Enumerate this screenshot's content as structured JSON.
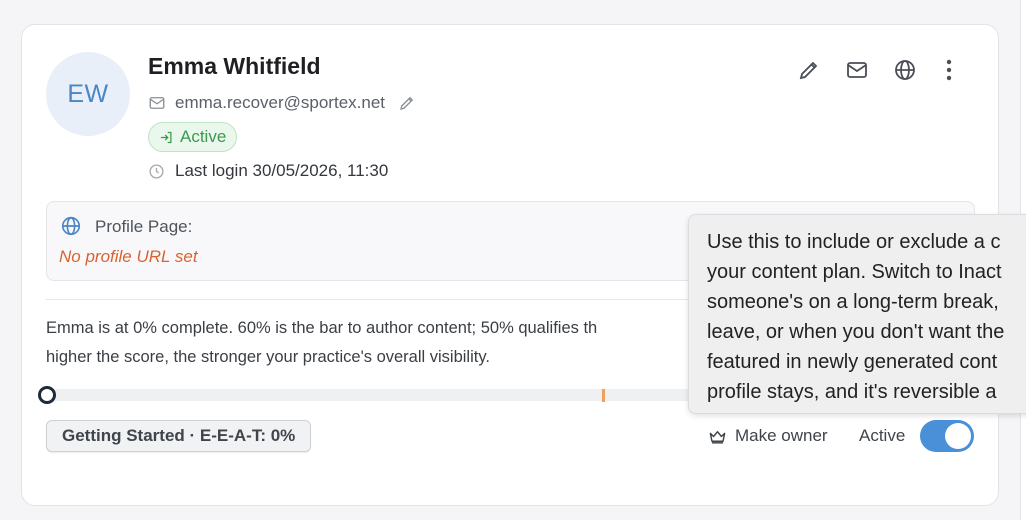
{
  "member": {
    "initials": "EW",
    "name": "Emma Whitfield",
    "email": "emma.recover@sportex.net",
    "status_badge": "Active",
    "last_login": "Last login 30/05/2026, 11:30"
  },
  "actions": {
    "icons": [
      "pencil-icon",
      "mail-icon",
      "globe-icon",
      "more-vertical-icon"
    ]
  },
  "profile": {
    "label": "Profile Page:",
    "empty_text": "No profile URL set"
  },
  "progress": {
    "description_line1": "Emma is at 0% complete. 60% is the bar to author content; 50% qualifies th",
    "description_line2": "higher the score, the stronger your practice's overall visibility.",
    "value_percent": 0,
    "marker_percent": 60,
    "level_label": "Getting Started · E-E-A-T: 0%"
  },
  "controls": {
    "make_owner_label": "Make owner",
    "status_label": "Active",
    "status_on": true
  },
  "tooltip": {
    "lines": [
      "Use this to include or exclude a c",
      "your content plan. Switch to Inact",
      "someone's on a long-term break,",
      "leave, or when you don't want the",
      "featured in newly generated cont",
      "profile stays, and it's reversible a"
    ]
  },
  "colors": {
    "accent": "#4a90d9",
    "success": "#3b9a4c",
    "warning": "#d9632f",
    "marker": "#f0a05a"
  }
}
